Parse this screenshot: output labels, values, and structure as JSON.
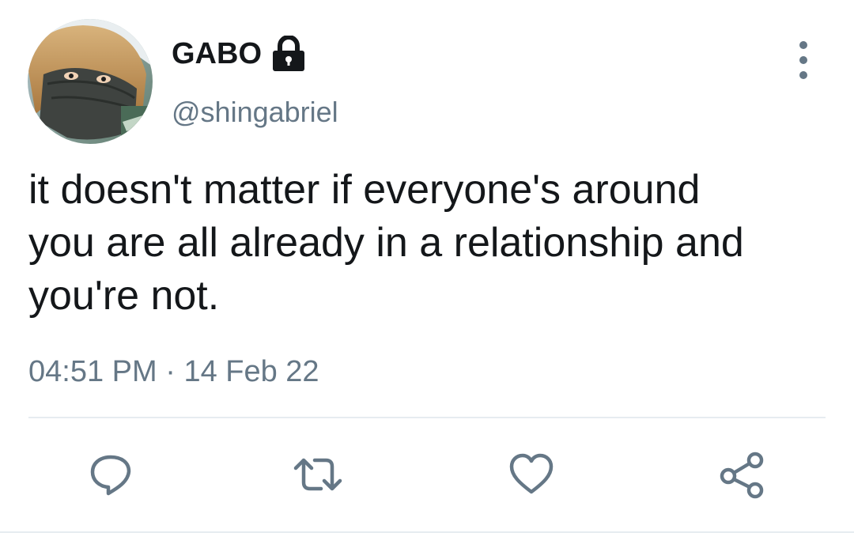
{
  "user": {
    "display_name": "GABO",
    "handle": "@shingabriel",
    "avatar_icon": "avatar-photo",
    "protected_icon": "lock-icon"
  },
  "tweet": {
    "text": "it doesn't matter if everyone's around\nyou are all already in a relationship and\nyou're not.",
    "time": "04:51 PM",
    "separator": "·",
    "date": "14 Feb 22"
  },
  "actions": [
    {
      "name": "reply",
      "icon": "reply-icon"
    },
    {
      "name": "retweet",
      "icon": "retweet-icon"
    },
    {
      "name": "like",
      "icon": "heart-icon"
    },
    {
      "name": "share",
      "icon": "share-icon"
    }
  ],
  "colors": {
    "text": "#14171a",
    "secondary": "#657786",
    "divider": "#e6ecf0"
  }
}
